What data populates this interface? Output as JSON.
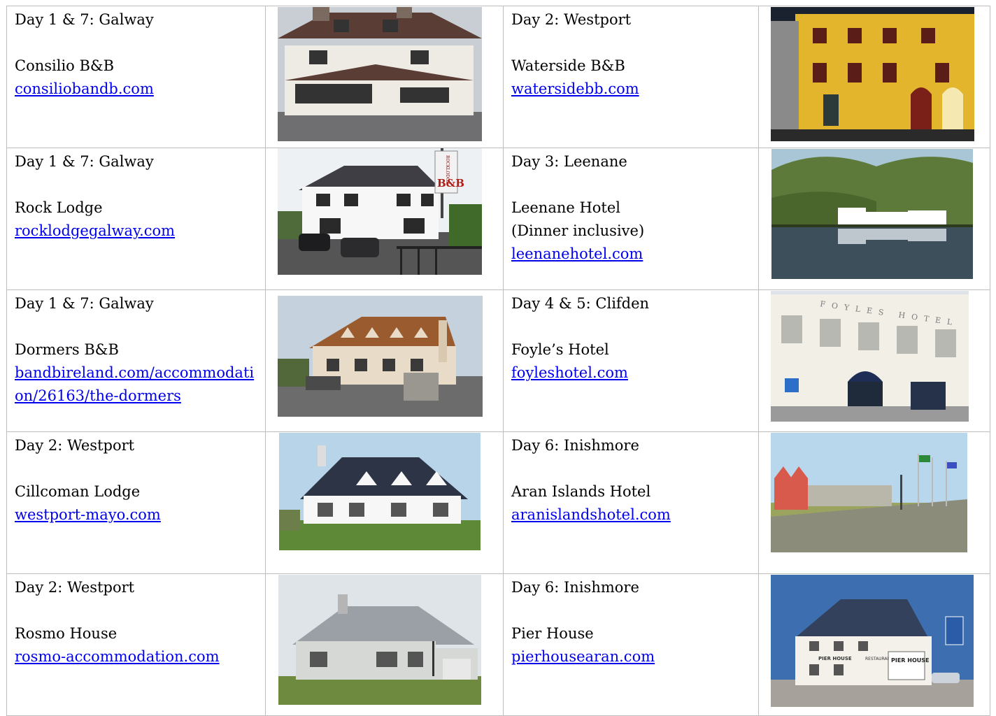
{
  "rows": [
    {
      "left": {
        "day": "Day 1 & 7: Galway",
        "name": "Consilio B&B",
        "extra": "",
        "link": "consiliobandb.com"
      },
      "right": {
        "day": "Day 2: Westport",
        "name": "Waterside B&B",
        "extra": "",
        "link": "watersidebb.com"
      }
    },
    {
      "left": {
        "day": "Day 1 & 7: Galway",
        "name": "Rock Lodge",
        "extra": "",
        "link": "rocklodgegalway.com"
      },
      "right": {
        "day": "Day 3: Leenane",
        "name": "Leenane Hotel",
        "extra": "(Dinner inclusive)",
        "link": "leenanehotel.com"
      }
    },
    {
      "left": {
        "day": "Day 1 & 7: Galway",
        "name": "Dormers B&B",
        "extra": "",
        "link": "bandbireland.com/accommodation/26163/the-dormers"
      },
      "right": {
        "day": "Day 4 & 5: Clifden",
        "name": "Foyle’s Hotel",
        "extra": "",
        "link": "foyleshotel.com"
      }
    },
    {
      "left": {
        "day": "Day 2: Westport",
        "name": "Cillcoman Lodge",
        "extra": "",
        "link": "westport-mayo.com"
      },
      "right": {
        "day": "Day 6: Inishmore",
        "name": "Aran Islands Hotel",
        "extra": "",
        "link": "aranislandshotel.com"
      }
    },
    {
      "left": {
        "day": "Day 2: Westport",
        "name": "Rosmo House",
        "extra": "",
        "link": "rosmo-accommodation.com"
      },
      "right": {
        "day": "Day 6: Inishmore",
        "name": "Pier House",
        "extra": "",
        "link": "pierhousearan.com"
      }
    }
  ],
  "sign_text": {
    "rocklodge": "ROCKLODGE",
    "rocklodge_bb": "B&B",
    "foyles": "FOYLES HOTEL",
    "pierhouse": "PIER HOUSE",
    "pierhouse_restaurant": "RESTAURANT"
  },
  "colors": {
    "link": "#0000ee",
    "border": "#bdbdbd",
    "text": "#000000"
  }
}
